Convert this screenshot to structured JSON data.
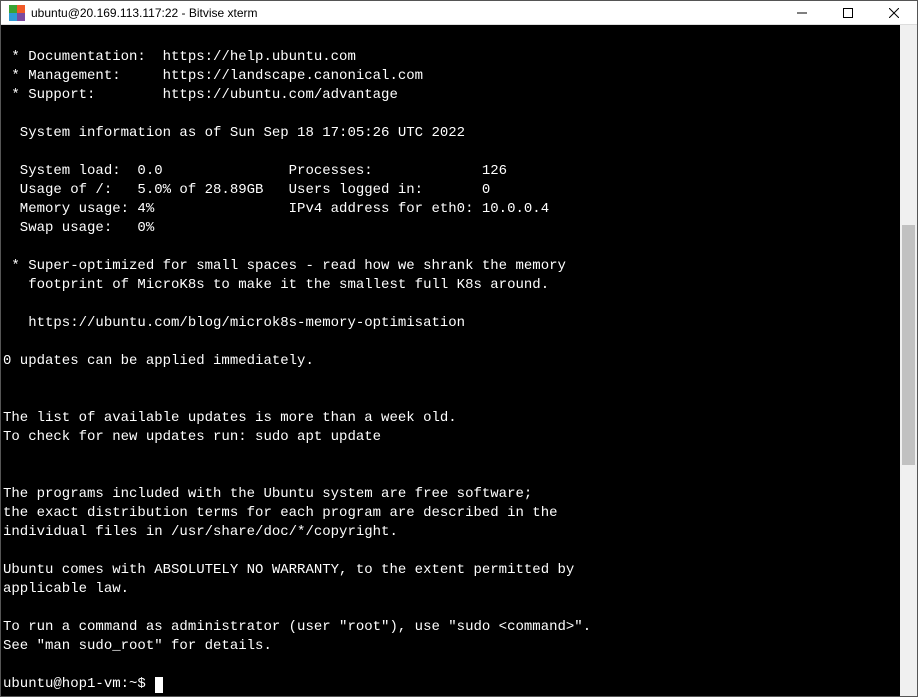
{
  "window": {
    "title": "ubuntu@20.169.113.117:22 - Bitvise xterm"
  },
  "terminal": {
    "lines": [
      "",
      " * Documentation:  https://help.ubuntu.com",
      " * Management:     https://landscape.canonical.com",
      " * Support:        https://ubuntu.com/advantage",
      "",
      "  System information as of Sun Sep 18 17:05:26 UTC 2022",
      "",
      "  System load:  0.0               Processes:             126",
      "  Usage of /:   5.0% of 28.89GB   Users logged in:       0",
      "  Memory usage: 4%                IPv4 address for eth0: 10.0.0.4",
      "  Swap usage:   0%",
      "",
      " * Super-optimized for small spaces - read how we shrank the memory",
      "   footprint of MicroK8s to make it the smallest full K8s around.",
      "",
      "   https://ubuntu.com/blog/microk8s-memory-optimisation",
      "",
      "0 updates can be applied immediately.",
      "",
      "",
      "The list of available updates is more than a week old.",
      "To check for new updates run: sudo apt update",
      "",
      "",
      "The programs included with the Ubuntu system are free software;",
      "the exact distribution terms for each program are described in the",
      "individual files in /usr/share/doc/*/copyright.",
      "",
      "Ubuntu comes with ABSOLUTELY NO WARRANTY, to the extent permitted by",
      "applicable law.",
      "",
      "To run a command as administrator (user \"root\"), use \"sudo <command>\".",
      "See \"man sudo_root\" for details.",
      ""
    ],
    "prompt": "ubuntu@hop1-vm:~$ "
  }
}
